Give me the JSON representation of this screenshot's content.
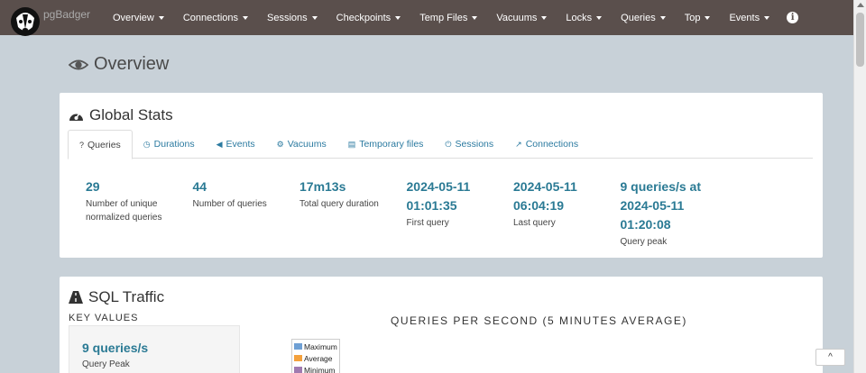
{
  "navbar": {
    "brand": "pgBadger",
    "items": [
      {
        "label": "Overview"
      },
      {
        "label": "Connections"
      },
      {
        "label": "Sessions"
      },
      {
        "label": "Checkpoints"
      },
      {
        "label": "Temp Files"
      },
      {
        "label": "Vacuums"
      },
      {
        "label": "Locks"
      },
      {
        "label": "Queries"
      },
      {
        "label": "Top"
      },
      {
        "label": "Events"
      }
    ],
    "info_icon": "i"
  },
  "page_title": "Overview",
  "global_stats": {
    "title": "Global Stats",
    "tabs": [
      {
        "label": "Queries",
        "icon": "question-circle-icon"
      },
      {
        "label": "Durations",
        "icon": "clock-icon"
      },
      {
        "label": "Events",
        "icon": "bullhorn-icon"
      },
      {
        "label": "Vacuums",
        "icon": "cogs-icon"
      },
      {
        "label": "Temporary files",
        "icon": "file-icon"
      },
      {
        "label": "Sessions",
        "icon": "power-icon"
      },
      {
        "label": "Connections",
        "icon": "external-link-icon"
      }
    ],
    "stats": [
      {
        "value_lines": [
          "29"
        ],
        "label_lines": [
          "Number of unique",
          "normalized queries"
        ]
      },
      {
        "value_lines": [
          "44"
        ],
        "label_lines": [
          "Number of queries"
        ]
      },
      {
        "value_lines": [
          "17m13s"
        ],
        "label_lines": [
          "Total query duration"
        ]
      },
      {
        "value_lines": [
          "2024-05-11",
          "01:01:35"
        ],
        "label_lines": [
          "First query"
        ]
      },
      {
        "value_lines": [
          "2024-05-11",
          "06:04:19"
        ],
        "label_lines": [
          "Last query"
        ]
      },
      {
        "value_lines": [
          "9 queries/s at",
          "2024-05-11",
          "01:20:08"
        ],
        "label_lines": [
          "Query peak"
        ]
      }
    ]
  },
  "sql_traffic": {
    "title": "SQL Traffic",
    "key_values_heading": "KEY VALUES",
    "key_value": "9 queries/s",
    "key_label": "Query Peak",
    "chart_title": "QUERIES PER SECOND (5 MINUTES AVERAGE)",
    "legend": [
      {
        "label": "Maximum",
        "color": "#6fa0d4"
      },
      {
        "label": "Average",
        "color": "#f4a13c"
      },
      {
        "label": "Minimum",
        "color": "#a07ab0"
      }
    ]
  },
  "to_top_label": "^",
  "colors": {
    "navbar_bg": "#5a4f4c",
    "page_bg": "#c8d1d8",
    "accent": "#2a7a94",
    "link": "#2b7aa0"
  }
}
